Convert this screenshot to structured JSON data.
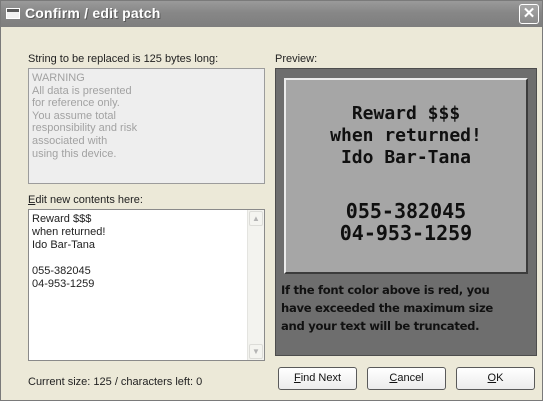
{
  "window": {
    "title": "Confirm / edit patch",
    "close_glyph": "✕"
  },
  "left": {
    "string_label": "String to be replaced is 125 bytes long:",
    "warning_lines": [
      "WARNING",
      "All data is presented",
      "for reference only.",
      "You assume total",
      "responsibility and risk",
      "associated with",
      "using this device."
    ],
    "edit_label_mnemonic": "E",
    "edit_label_rest": "dit new contents here:",
    "edit_text": "Reward $$$\nwhen returned!\nIdo Bar-Tana\n\n055-382045\n04-953-1259",
    "scroll_up_glyph": "▲",
    "scroll_down_glyph": "▼",
    "status": "Current size: 125 / characters left: 0"
  },
  "preview": {
    "label": "Preview:",
    "lines": [
      "Reward $$$",
      "when returned!",
      "Ido Bar-Tana",
      "",
      "055-382045",
      "04-953-1259"
    ],
    "note_lines": [
      "If the font color above is red, you",
      "have exceeded the maximum size",
      "and your text will be truncated."
    ]
  },
  "buttons": {
    "find_next": {
      "mnemonic": "F",
      "rest": "ind Next"
    },
    "cancel": {
      "mnemonic": "C",
      "rest": "ancel"
    },
    "ok": {
      "mnemonic": "O",
      "rest": "K"
    }
  },
  "colors": {
    "dialog_bg": "#ece9d8",
    "titlebar": "#878787",
    "preview_screen": "#a6a6a6",
    "preview_frame": "#6e6e6e"
  },
  "icons": {
    "window_icon": "window-icon",
    "close": "close-icon"
  }
}
